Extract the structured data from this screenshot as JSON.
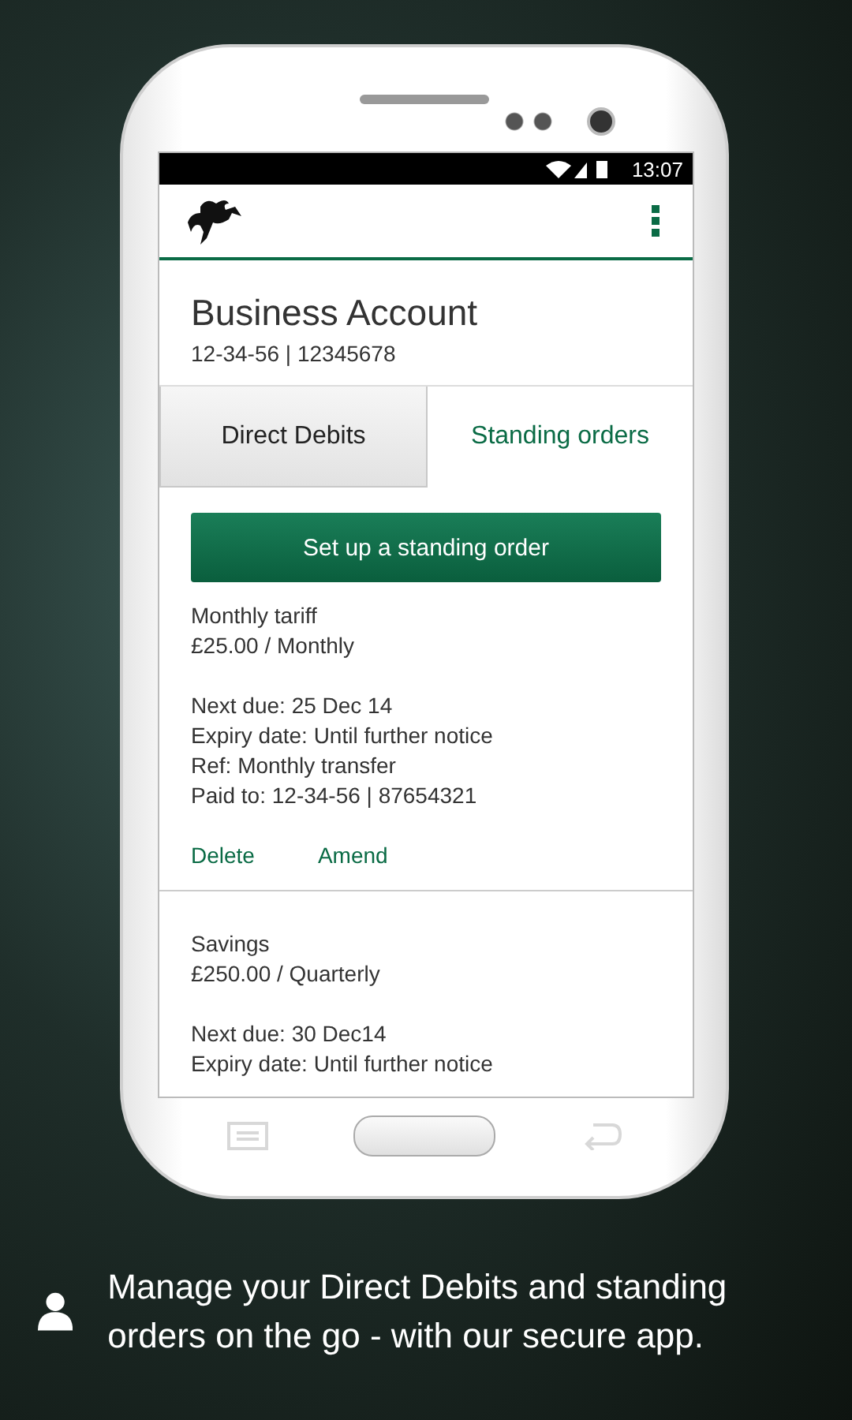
{
  "status_bar": {
    "time": "13:07"
  },
  "account": {
    "name": "Business Account",
    "number": "12-34-56 | 12345678"
  },
  "tabs": [
    {
      "label": "Direct Debits",
      "selected": false
    },
    {
      "label": "Standing orders",
      "selected": true
    }
  ],
  "primary_button": "Set up a standing order",
  "orders": [
    {
      "name": "Monthly tariff",
      "amount": "£25.00 / Monthly",
      "details": [
        "Next due: 25 Dec 14",
        "Expiry date: Until further notice",
        "Ref: Monthly transfer",
        "Paid to: 12-34-56 | 87654321"
      ],
      "actions": [
        "Delete",
        "Amend"
      ]
    },
    {
      "name": "Savings",
      "amount": "£250.00 / Quarterly",
      "details": [
        "Next due: 30 Dec14",
        "Expiry date: Until further notice"
      ]
    }
  ],
  "caption": "Manage your Direct Debits and standing orders on the go - with our secure app."
}
